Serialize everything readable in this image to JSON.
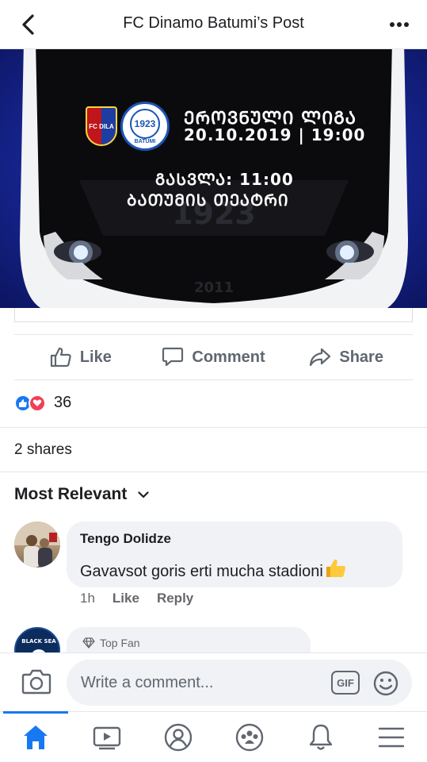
{
  "header": {
    "title": "FC Dinamo Batumi’s Post"
  },
  "post_image": {
    "line1": "ᲔᲠᲝᲕᲜᲣᲚᲘ ᲚᲘᲒᲐ",
    "line2": "20.10.2019 | 19:00",
    "line3": "ᲒᲐᲡᲕᲚᲐ: 11:00",
    "line4": "ᲑᲐᲗᲣᲛᲘᲡ ᲗᲔᲐᲢᲠᲘ",
    "logo_a_text": "FC DILA",
    "logo_b_year": "1923",
    "logo_b_text": "BATUMI",
    "bus_year": "1923",
    "bus_plate": "2011"
  },
  "actions": {
    "like": "Like",
    "comment": "Comment",
    "share": "Share"
  },
  "reactions": {
    "count": "36"
  },
  "shares": {
    "label": "2 shares"
  },
  "sort": {
    "label": "Most Relevant"
  },
  "comments": [
    {
      "author": "Tengo  Dolidze",
      "text": "Gavavsot goris erti mucha stadioni",
      "time": "1h",
      "like": "Like",
      "reply": "Reply"
    },
    {
      "badge": "Top Fan",
      "avatar_text": "BLACK SEA"
    }
  ],
  "composer": {
    "placeholder": "Write a comment...",
    "gif": "GIF"
  },
  "colors": {
    "accent": "#1877f2",
    "love": "#f33e58",
    "muted": "#606770"
  }
}
